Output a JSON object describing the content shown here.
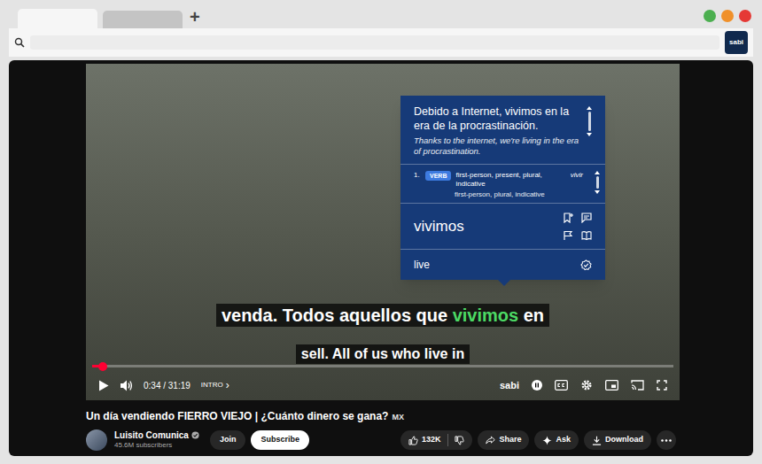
{
  "browser": {
    "tabs": [
      {
        "selected": true
      },
      {
        "selected": false
      }
    ],
    "new_tab": "+",
    "window_controls": [
      {
        "color": "#4caf50"
      },
      {
        "color": "#f0902a"
      },
      {
        "color": "#e53935"
      }
    ],
    "extension": {
      "label": "sabi"
    }
  },
  "popup": {
    "sentence": "Debido a Internet, vivimos en la era de la procrastinación.",
    "translation": "Thanks to the internet, we're living in the era of procrastination.",
    "definitions": [
      {
        "number": "1.",
        "tag": "VERB",
        "text": "first-person, present, plural, indicative",
        "lemma": "vivir"
      }
    ],
    "next_definition_peek": "first-person, plural, indicative",
    "word": "vivimos",
    "meaning": "live"
  },
  "subtitles": {
    "original": [
      {
        "text": "venda. Todos aquellos que ",
        "highlight": false
      },
      {
        "text": "vivimos",
        "highlight": true
      },
      {
        "text": " en",
        "highlight": false
      }
    ],
    "translation": "sell. All of us who live in"
  },
  "player": {
    "progress": {
      "level": 0.018
    },
    "time": "0:34 / 31:19",
    "chapter": "INTRO",
    "chapter_arrow": "›",
    "logo": "sabi"
  },
  "video": {
    "title": "Un día vendiendo FIERRO VIEJO | ¿Cuánto dinero se gana?",
    "region": "MX"
  },
  "channel": {
    "name": "Luisito Comunica",
    "verified": true,
    "subscribers": "45.6M subscribers"
  },
  "actions": {
    "join": "Join",
    "subscribe": "Subscribe",
    "likes": "132K",
    "share": "Share",
    "ask": "Ask",
    "download": "Download"
  }
}
